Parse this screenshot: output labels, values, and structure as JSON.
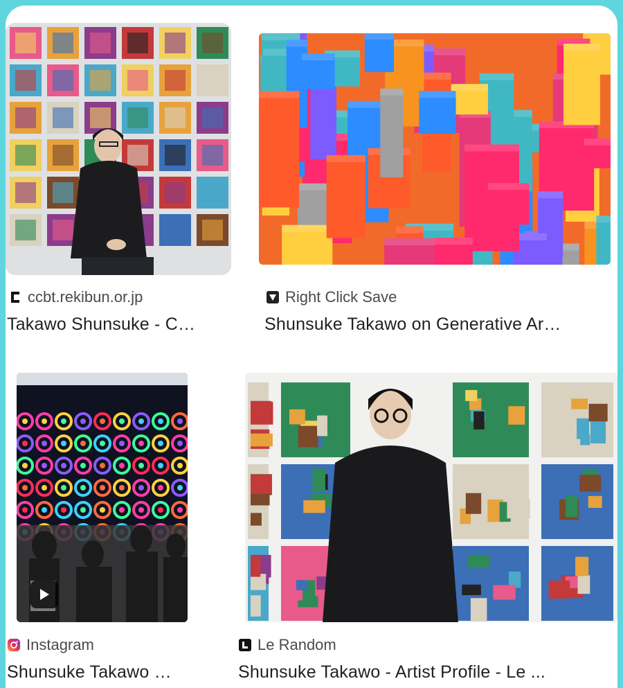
{
  "results": [
    {
      "source": "ccbt.rekibun.or.jp",
      "favicon": "c-logo-icon",
      "title": "Takawo Shunsuke - C…"
    },
    {
      "source": "Right Click Save",
      "favicon": "save-shield-icon",
      "title": "Shunsuke Takawo on Generative Ar…"
    },
    {
      "source": "Instagram",
      "favicon": "instagram-icon",
      "title": "Shunsuke Takawo …",
      "video": true
    },
    {
      "source": "Le Random",
      "favicon": "le-random-icon",
      "title": "Shunsuke Takawo - Artist Profile - Le ..."
    }
  ],
  "colors": {
    "frame": "#5fd6dd",
    "text": "#202124",
    "source_text": "#4a4a4a"
  }
}
